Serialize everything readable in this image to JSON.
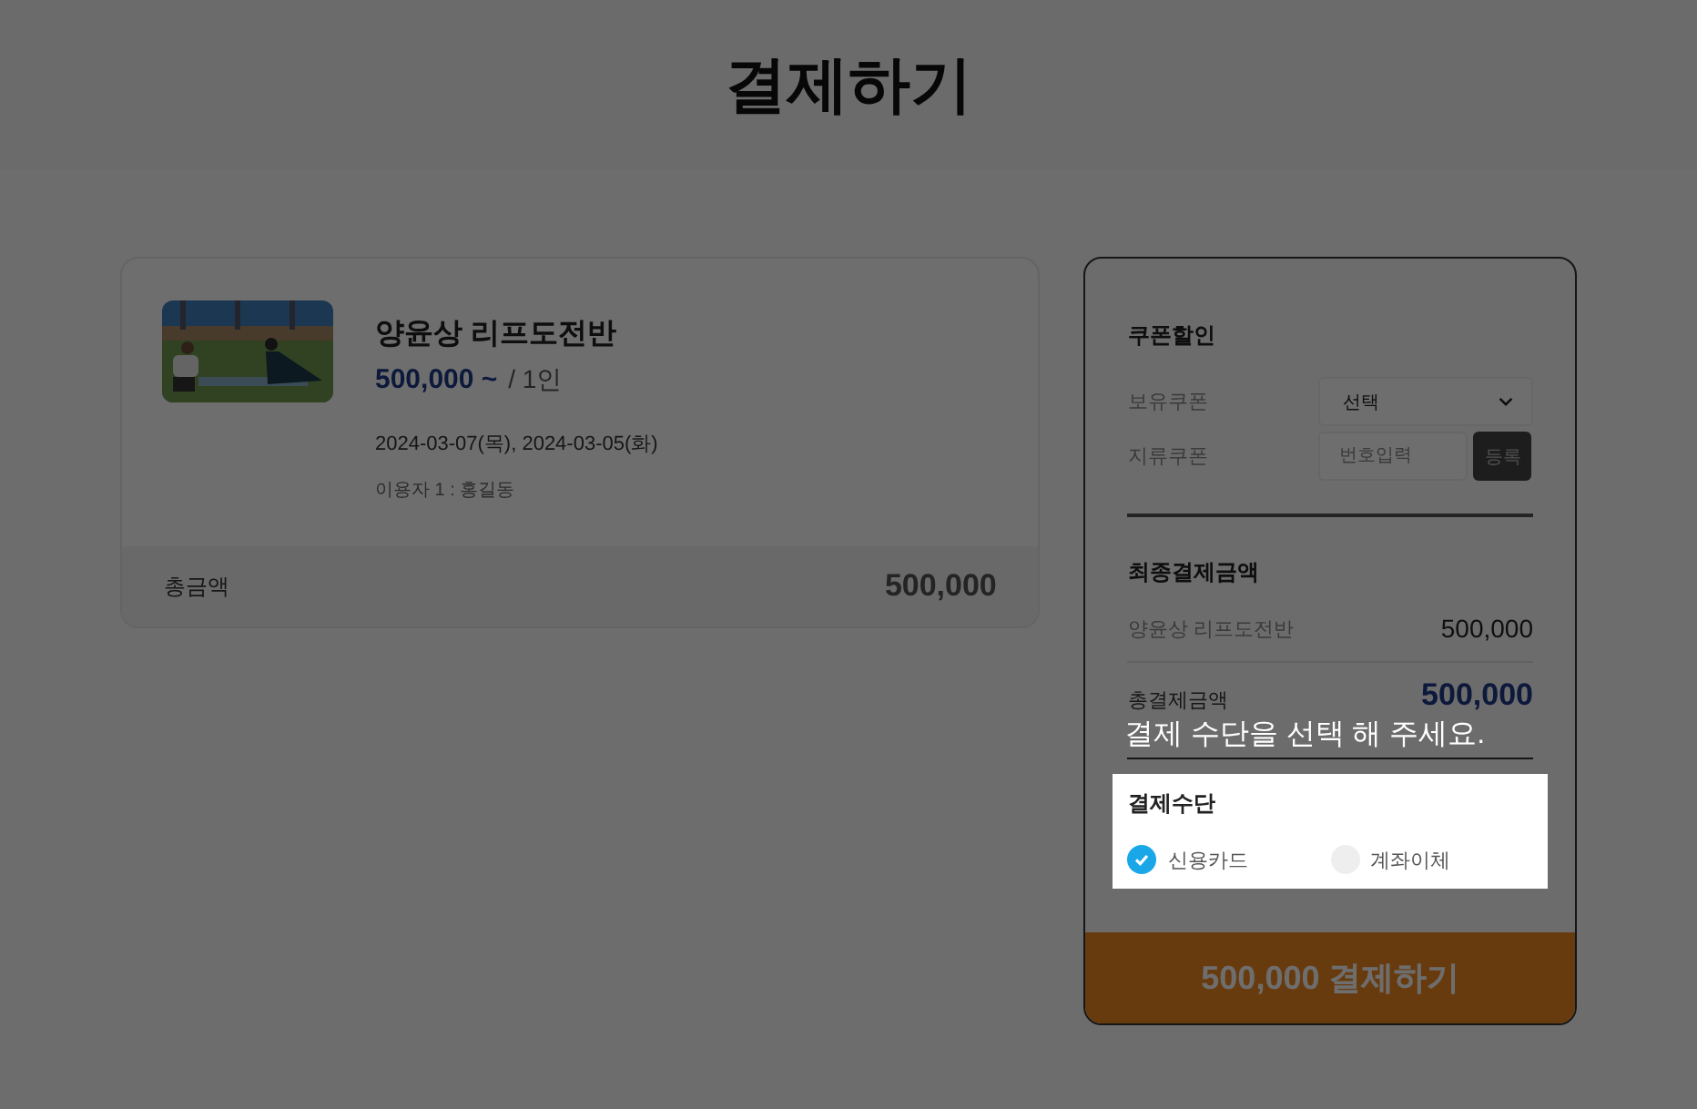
{
  "page": {
    "title": "결제하기"
  },
  "product": {
    "name": "양윤상 리프도전반",
    "price": "500,000 ~",
    "unit": "/ 1인",
    "dates": "2024-03-07(목), 2024-03-05(화)",
    "user": "이용자 1 : 홍길동",
    "total_label": "총금액",
    "total": "500,000"
  },
  "coupon": {
    "title": "쿠폰할인",
    "owned_label": "보유쿠폰",
    "owned_value": "선택",
    "paper_label": "지류쿠폰",
    "paper_placeholder": "번호입력",
    "register": "등록"
  },
  "summary": {
    "title": "최종결제금액",
    "item_label": "양윤상 리프도전반",
    "item_amount": "500,000",
    "total_label": "총결제금액",
    "total_amount": "500,000"
  },
  "payment": {
    "title": "결제수단",
    "methods": [
      {
        "label": "신용카드",
        "selected": true
      },
      {
        "label": "계좌이체",
        "selected": false
      }
    ]
  },
  "pay_button": "500,000 결제하기",
  "guide": {
    "on": true,
    "message": "결제 수단을 선택 해 주세요."
  }
}
